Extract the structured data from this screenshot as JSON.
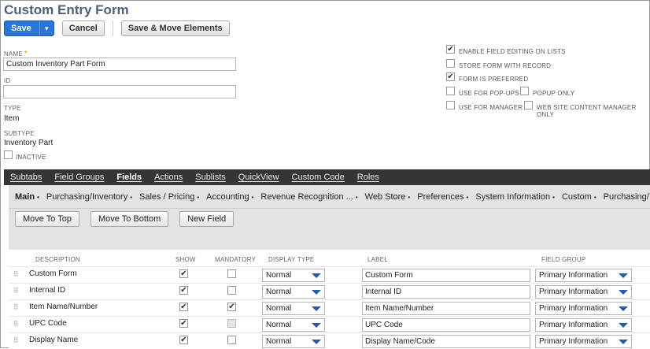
{
  "page": {
    "title": "Custom Entry Form"
  },
  "toolbar": {
    "save_label": "Save",
    "cancel_label": "Cancel",
    "save_move_label": "Save & Move Elements"
  },
  "form": {
    "name_label": "NAME",
    "name_required": "*",
    "name_value": "Custom Inventory Part Form",
    "id_label": "ID",
    "id_value": "",
    "type_label": "TYPE",
    "type_value": "Item",
    "subtype_label": "SUBTYPE",
    "subtype_value": "Inventory Part",
    "inactive_label": "INACTIVE"
  },
  "options": {
    "enable_field_editing": {
      "label": "ENABLE FIELD EDITING ON LISTS",
      "checked": true
    },
    "store_form": {
      "label": "STORE FORM WITH RECORD",
      "checked": false
    },
    "form_preferred": {
      "label": "FORM IS PREFERRED",
      "checked": true
    },
    "use_popups": {
      "label": "USE FOR POP-UPS",
      "checked": false
    },
    "popup_only": {
      "label": "POPUP ONLY",
      "checked": false
    },
    "use_manager": {
      "label": "USE FOR MANAGER",
      "checked": false
    },
    "website_manager": {
      "label": "WEB SITE CONTENT MANAGER ONLY",
      "checked": false
    }
  },
  "tabs": [
    "Subtabs",
    "Field Groups",
    "Fields",
    "Actions",
    "Sublists",
    "QuickView",
    "Custom Code",
    "Roles"
  ],
  "active_tab": "Fields",
  "subtabs": [
    "Main",
    "Purchasing/Inventory",
    "Sales / Pricing",
    "Accounting",
    "Revenue Recognition ...",
    "Web Store",
    "Preferences",
    "System Information",
    "Custom",
    "Purchasing/"
  ],
  "subtab_dot": "•",
  "actions": {
    "move_top": "Move To Top",
    "move_bottom": "Move To Bottom",
    "new_field": "New Field"
  },
  "grid": {
    "headers": {
      "description": "DESCRIPTION",
      "show": "SHOW",
      "mandatory": "MANDATORY",
      "display_type": "DISPLAY TYPE",
      "label": "LABEL",
      "field_group": "FIELD GROUP"
    },
    "rows": [
      {
        "description": "Custom Form",
        "show": true,
        "mandatory": false,
        "mandatory_disabled": false,
        "display_type": "Normal",
        "label": "Custom Form",
        "field_group": "Primary Information"
      },
      {
        "description": "Internal ID",
        "show": true,
        "mandatory": false,
        "mandatory_disabled": false,
        "display_type": "Normal",
        "label": "Internal ID",
        "field_group": "Primary Information"
      },
      {
        "description": "Item Name/Number",
        "show": true,
        "mandatory": true,
        "mandatory_disabled": false,
        "display_type": "Normal",
        "label": "Item Name/Number",
        "field_group": "Primary Information"
      },
      {
        "description": "UPC Code",
        "show": true,
        "mandatory": false,
        "mandatory_disabled": true,
        "display_type": "Normal",
        "label": "UPC Code",
        "field_group": "Primary Information"
      },
      {
        "description": "Display Name",
        "show": true,
        "mandatory": false,
        "mandatory_disabled": false,
        "display_type": "Normal",
        "label": "Display Name/Code",
        "field_group": "Primary Information"
      }
    ]
  },
  "colors": {
    "title": "#4d5f79",
    "primary_button": "#2a75d6",
    "tabbar": "#353535"
  }
}
